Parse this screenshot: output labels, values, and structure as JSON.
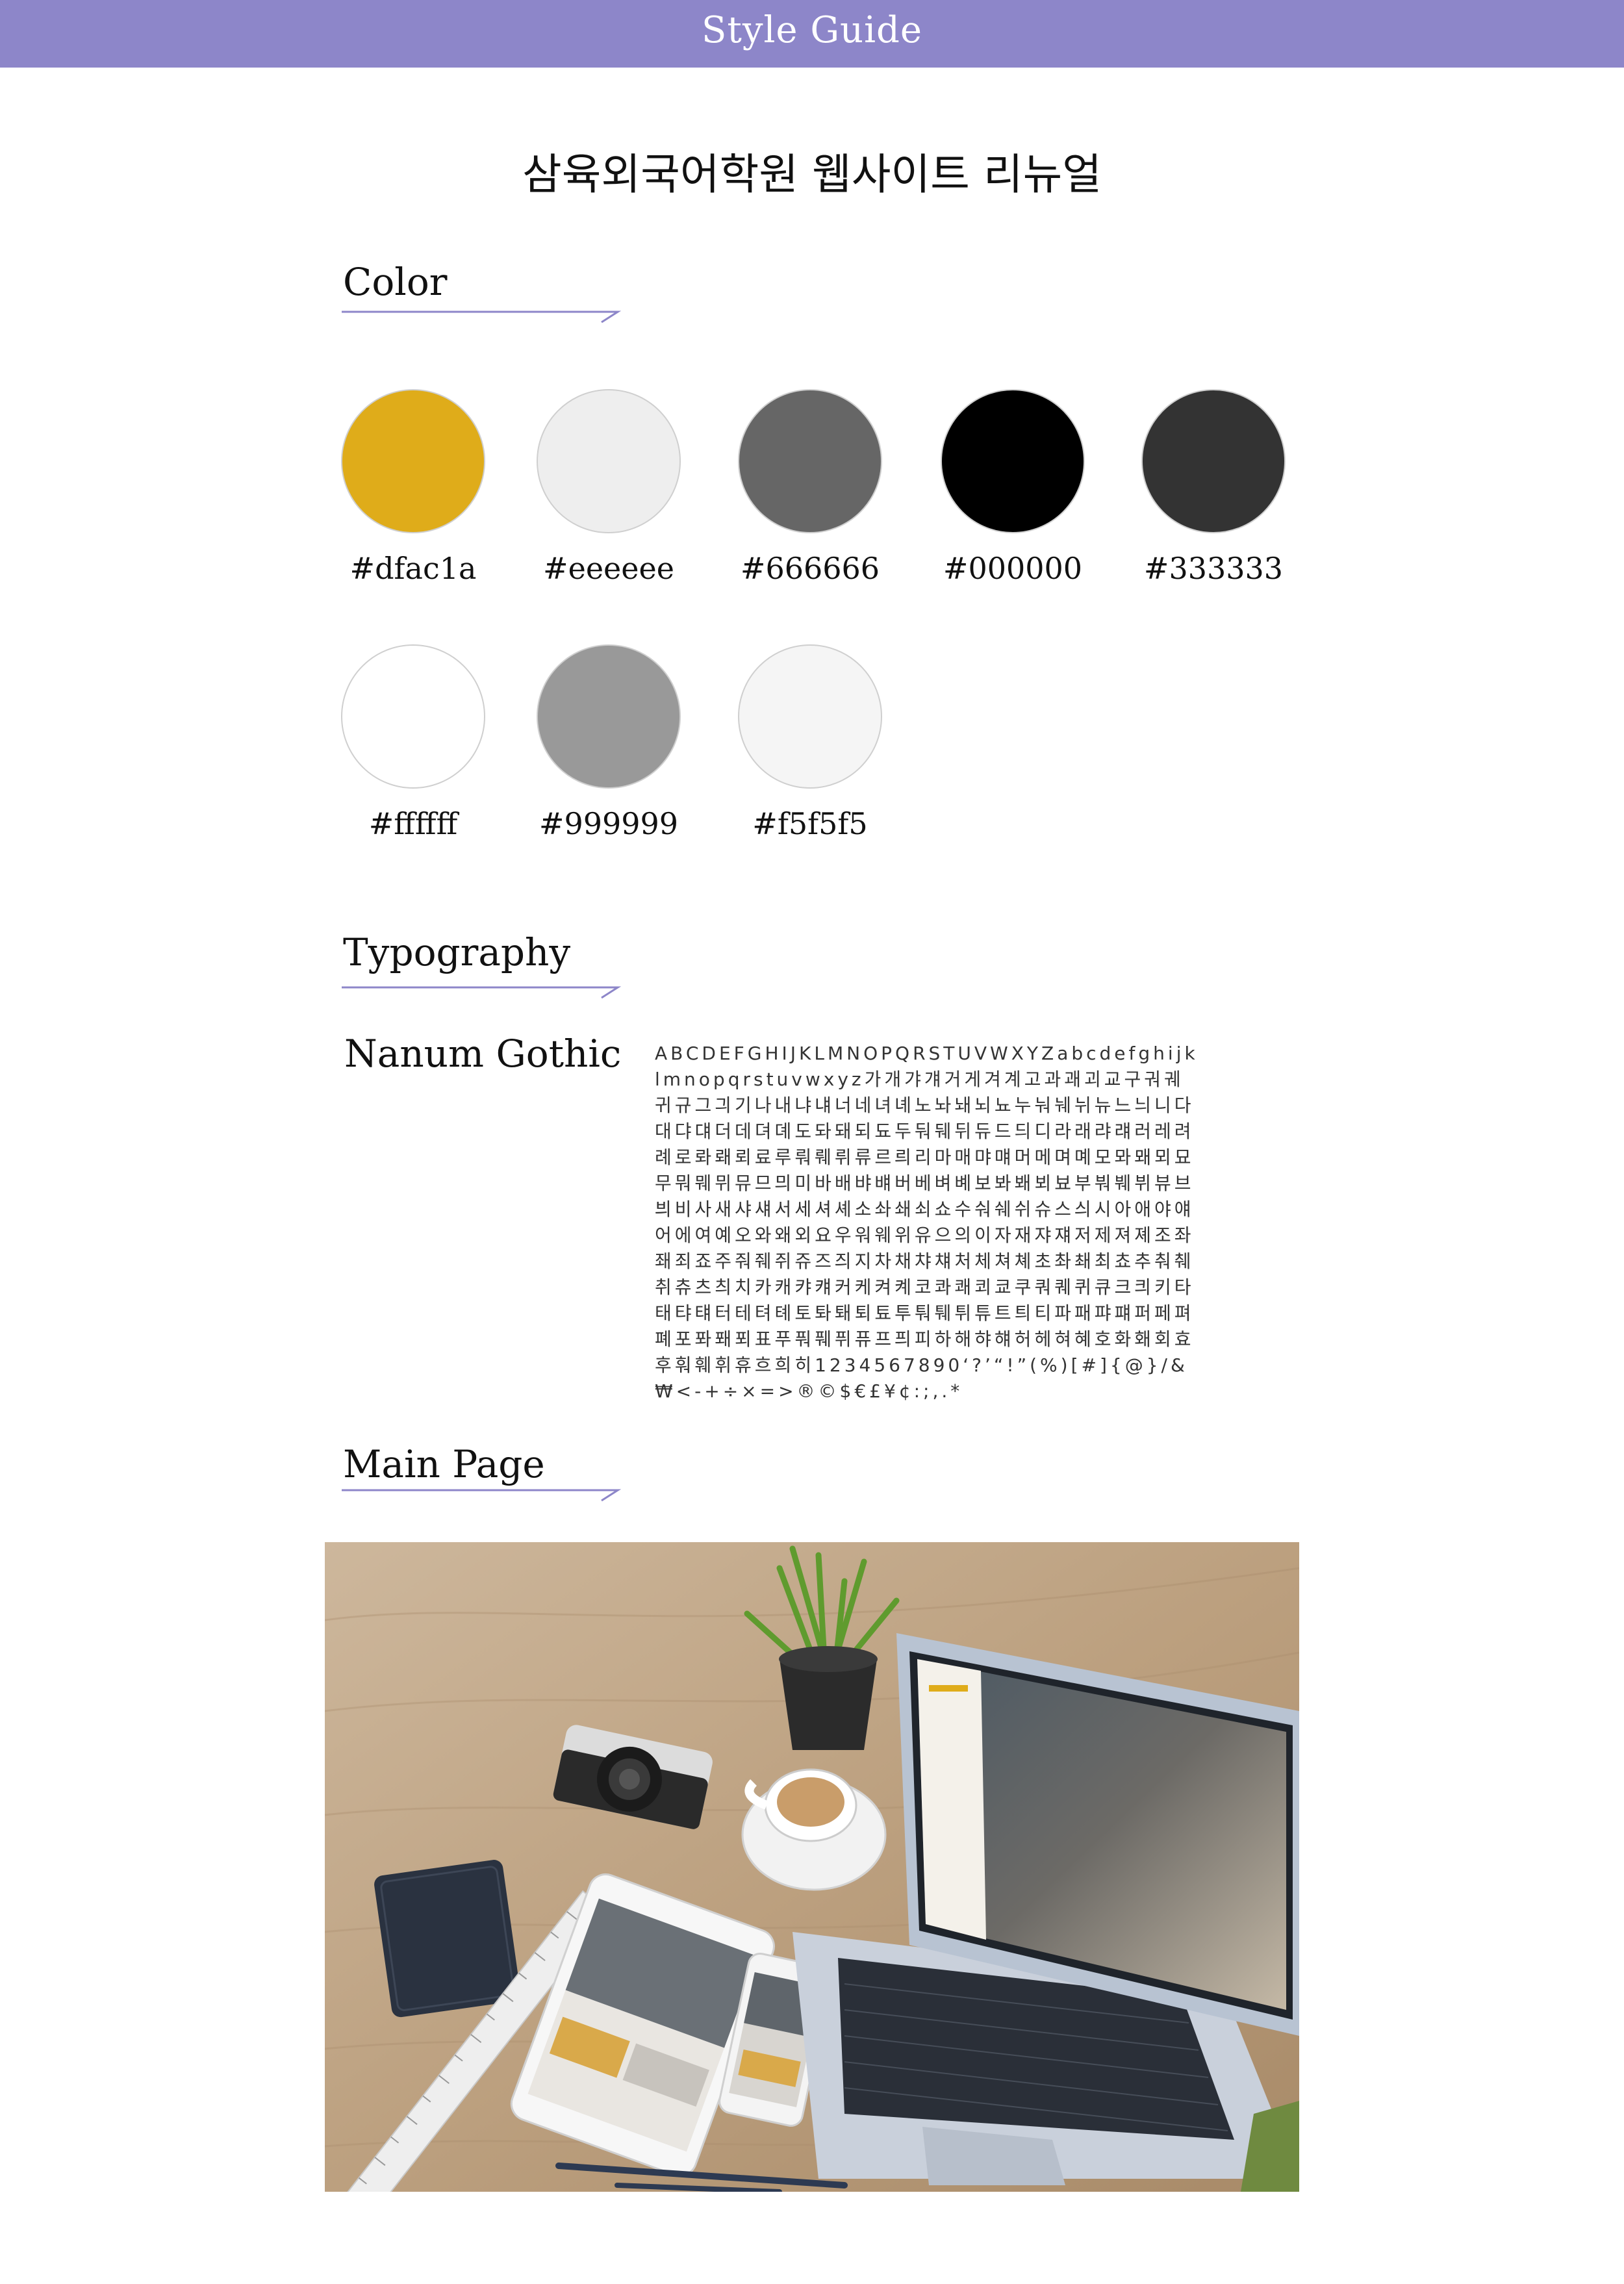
{
  "header": {
    "title": "Style Guide"
  },
  "project_title": "삼육외국어학원 웹사이트 리뉴얼",
  "sections": {
    "color": "Color",
    "typography": "Typography",
    "main_page": "Main Page"
  },
  "colors": [
    {
      "hex": "#dfac1a",
      "label": "#dfac1a"
    },
    {
      "hex": "#eeeeee",
      "label": "#eeeeee"
    },
    {
      "hex": "#666666",
      "label": "#666666"
    },
    {
      "hex": "#000000",
      "label": "#000000"
    },
    {
      "hex": "#333333",
      "label": "#333333"
    },
    {
      "hex": "#ffffff",
      "label": "#ffffff"
    },
    {
      "hex": "#999999",
      "label": "#999999"
    },
    {
      "hex": "#f5f5f5",
      "label": "#f5f5f5"
    }
  ],
  "typography": {
    "font_name": "Nanum Gothic",
    "sample": "ABCDEFGHIJKLMNOPQRSTUVWXYZabcdefghijklmnopqrstuvwxyz가개갸걔거게겨계고과괘괴교구궈궤귀규그긔기나내냐냬너네녀녜노놔놰뇌뇨누눠눼뉘뉴느늬니다대댜댸더데뎌뎨도돠돼되됴두둬뒈뒤듀드듸디라래랴럐러레려례로롸뢔뢰료루뤄뤠뤼류르릐리마매먀먜머메며몌모뫄뫠뫼묘무뭐뭬뮈뮤므믜미바배뱌뱨버베벼볘보봐봬뵈뵤부붜붸뷔뷰브븨비사새샤섀서세셔셰소솨쇄쇠쇼수숴쉐쉬슈스싀시아애야얘어에여예오와왜외요우워웨위유으의이자재쟈쟤저제져졔조좌좨죄죠주줘줴쥐쥬즈즤지차채챠챼처체쳐쳬초촤쵀최쵸추춰췌취츄츠츼치카캐캬컈커케켜켸코콰쾌쾨쿄쿠쿼퀘퀴큐크킈키타태탸턔터테텨톄토톼퇘퇴툐투퉈퉤튀튜트틔티파패퍄퍠퍼페펴폐포퐈퐤푀표푸풔풰퓌퓨프픠피하해햐햬허헤혀혜호화홰회효후훠훼휘휴흐희히1234567890‘?’“!”(%)[#]{@}/&₩<-+÷×=>®©$€£¥¢:;,.*"
  }
}
